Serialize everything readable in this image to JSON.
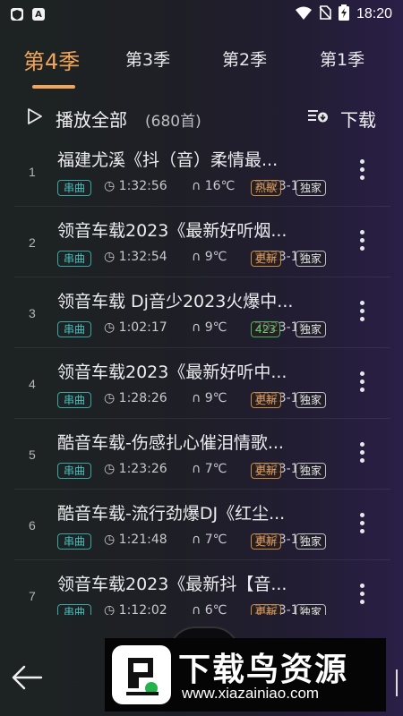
{
  "status_bar": {
    "time": "18:20",
    "left_icons": [
      "shield-icon",
      "app-a-icon"
    ],
    "right_icons": [
      "wifi-icon",
      "no-sim-icon",
      "battery-charging-icon"
    ],
    "app_a_glyph": "A"
  },
  "tabs": [
    {
      "label": "第4季",
      "active": true
    },
    {
      "label": "第3季",
      "active": false
    },
    {
      "label": "第2季",
      "active": false
    },
    {
      "label": "第1季",
      "active": false
    }
  ],
  "play_all": {
    "label": "播放全部",
    "count": "(680首)",
    "download_label": "下载"
  },
  "songs": [
    {
      "num": "1",
      "title": "福建尤溪《抖（音）柔情最...",
      "tag": "串曲",
      "duration": "1:32:56",
      "temp": "16℃",
      "date": "2023-1",
      "badge": "热歌",
      "badge_color": "orange",
      "exclusive": "独家"
    },
    {
      "num": "2",
      "title": "领音车载2023《最新好听烟...",
      "tag": "串曲",
      "duration": "1:32:54",
      "temp": "9℃",
      "date": "2023-10",
      "badge": "更新",
      "badge_color": "orange",
      "exclusive": "独家"
    },
    {
      "num": "3",
      "title": "领音车载 Dj音少2023火爆中...",
      "tag": "串曲",
      "duration": "1:02:17",
      "temp": "9℃",
      "date": "2023-10",
      "badge": "423",
      "badge_color": "green",
      "exclusive": "独家"
    },
    {
      "num": "4",
      "title": "领音车载2023《最新好听中...",
      "tag": "串曲",
      "duration": "1:28:26",
      "temp": "9℃",
      "date": "2023-10",
      "badge": "更新",
      "badge_color": "orange",
      "exclusive": "独家"
    },
    {
      "num": "5",
      "title": "酷音车载-伤感扎心催泪情歌...",
      "tag": "串曲",
      "duration": "1:23:26",
      "temp": "7℃",
      "date": "2023-10",
      "badge": "更新",
      "badge_color": "orange",
      "exclusive": "独家"
    },
    {
      "num": "6",
      "title": "酷音车载-流行劲爆DJ《红尘...",
      "tag": "串曲",
      "duration": "1:21:48",
      "temp": "7℃",
      "date": "2023-10",
      "badge": "更新",
      "badge_color": "orange",
      "exclusive": "独家"
    },
    {
      "num": "7",
      "title": "领音车载2023《最新抖【音...",
      "tag": "串曲",
      "duration": "1:12:02",
      "temp": "6℃",
      "date": "2023-10",
      "badge": "更新",
      "badge_color": "orange",
      "exclusive": "独家"
    }
  ],
  "bottom_bar": {
    "back_icon": "back-arrow-icon"
  },
  "watermark": {
    "title": "下载鸟资源",
    "url": "www.xiazainiao.com",
    "logo_glyph": "鸟"
  },
  "colors": {
    "accent": "#f2a55a",
    "tag": "#47c2bf",
    "badge_orange": "#e49a55",
    "badge_green": "#5bd06c"
  }
}
